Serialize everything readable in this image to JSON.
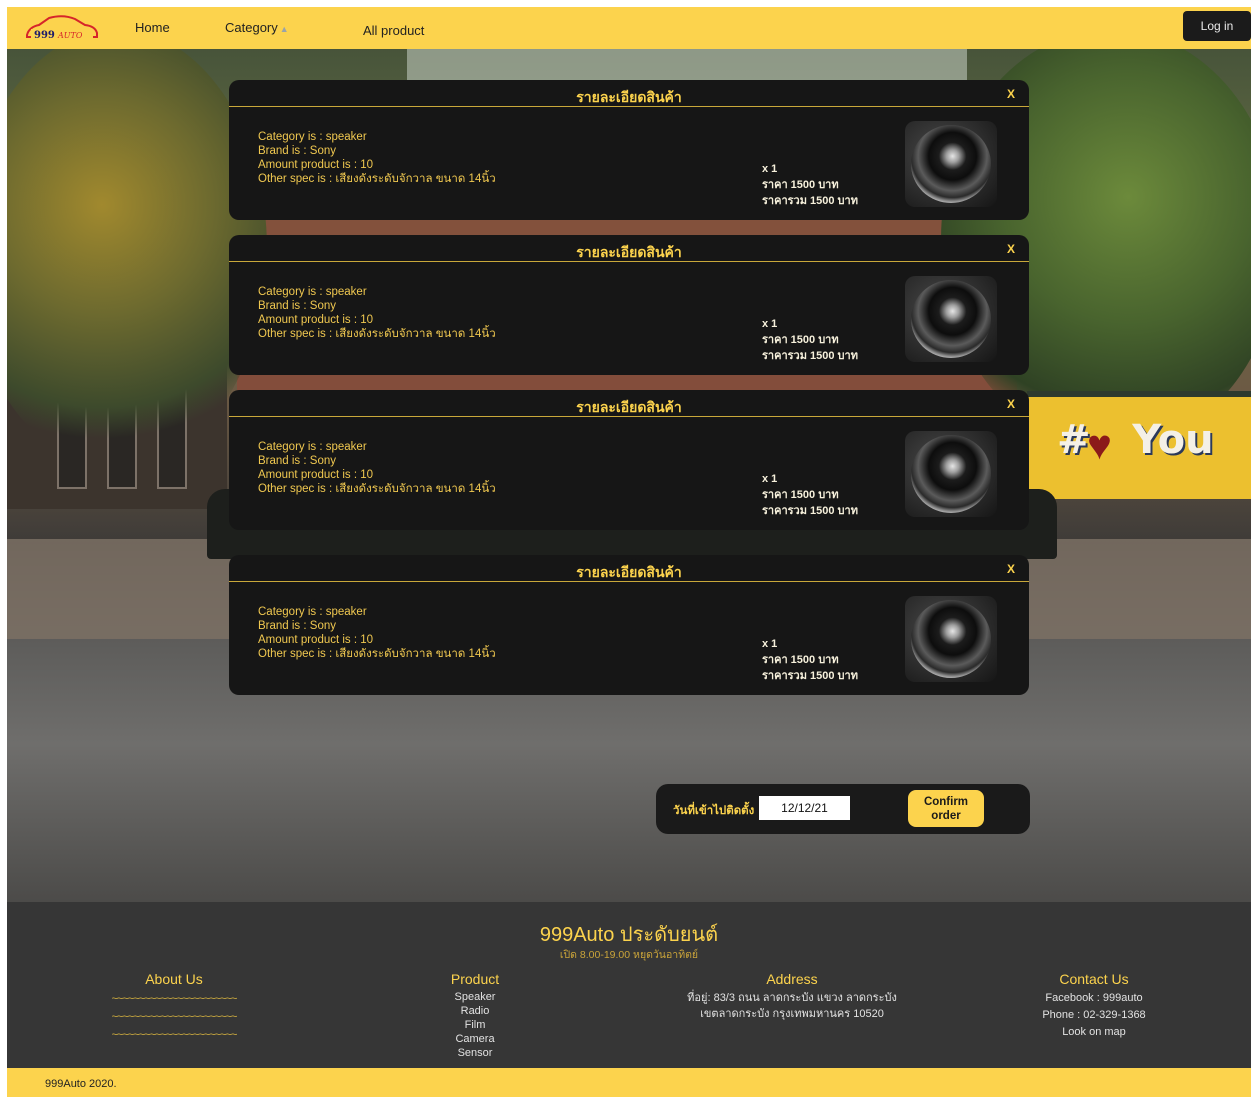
{
  "navbar": {
    "logo_text": "999 AUTO",
    "home": "Home",
    "category": "Category",
    "category_caret": "▲",
    "all_product": "All product",
    "login": "Log in"
  },
  "cards": [
    {
      "title": "รายละเอียดสินค้า",
      "close": "X",
      "category": "Category is : speaker",
      "brand": "Brand is : Sony",
      "amount": "Amount product is : 10",
      "other_spec": "Other spec is : เสียงดังระดับจักวาล ขนาด 14นิ้ว",
      "qty": "x 1",
      "price": "ราคา 1500 บาท",
      "total": "ราคารวม 1500 บาท",
      "image": "speaker-image"
    },
    {
      "title": "รายละเอียดสินค้า",
      "close": "X",
      "category": "Category is : speaker",
      "brand": "Brand is : Sony",
      "amount": "Amount product is : 10",
      "other_spec": "Other spec is : เสียงดังระดับจักวาล ขนาด 14นิ้ว",
      "qty": "x 1",
      "price": "ราคา 1500 บาท",
      "total": "ราคารวม 1500 บาท",
      "image": "speaker-image"
    },
    {
      "title": "รายละเอียดสินค้า",
      "close": "X",
      "category": "Category is : speaker",
      "brand": "Brand is : Sony",
      "amount": "Amount product is : 10",
      "other_spec": "Other spec is : เสียงดังระดับจักวาล ขนาด 14นิ้ว",
      "qty": "x 1",
      "price": "ราคา 1500 บาท",
      "total": "ราคารวม 1500 บาท",
      "image": "speaker-image"
    },
    {
      "title": "รายละเอียดสินค้า",
      "close": "X",
      "category": "Category is : speaker",
      "brand": "Brand is : Sony",
      "amount": "Amount product is : 10",
      "other_spec": "Other spec is : เสียงดังระดับจักวาล ขนาด 14นิ้ว",
      "qty": "x 1",
      "price": "ราคา 1500 บาท",
      "total": "ราคารวม 1500 บาท",
      "image": "speaker-image"
    }
  ],
  "order": {
    "label": "วันที่เข้าไปติดตั้ง",
    "date_value": "12/12/21",
    "confirm_line1": "Confirm",
    "confirm_line2": "order"
  },
  "footer": {
    "brand": "999Auto ประดับยนต์",
    "hours": "เปิด 8.00-19.00 หยุดวันอาทิตย์",
    "about": {
      "title": "About Us",
      "lines": [
        "~~~~~~~~~~~~~~~~~~~~~~~",
        "~~~~~~~~~~~~~~~~~~~~~~~",
        "~~~~~~~~~~~~~~~~~~~~~~~"
      ]
    },
    "product": {
      "title": "Product",
      "items": [
        "Speaker",
        "Radio",
        "Film",
        "Camera",
        "Sensor"
      ]
    },
    "address": {
      "title": "Address",
      "line1": "ที่อยู่: 83/3 ถนน ลาดกระบัง แขวง ลาดกระบัง",
      "line2": "เขตลาดกระบัง กรุงเทพมหานคร 10520"
    },
    "contact": {
      "title": "Contact Us",
      "facebook": "Facebook : 999auto",
      "phone": "Phone : 02-329-1368",
      "map": "Look on map"
    },
    "copyright": "999Auto 2020."
  },
  "colors": {
    "accent": "#fcd34d",
    "card_bg": "#161616",
    "footer_bg": "#363636"
  }
}
